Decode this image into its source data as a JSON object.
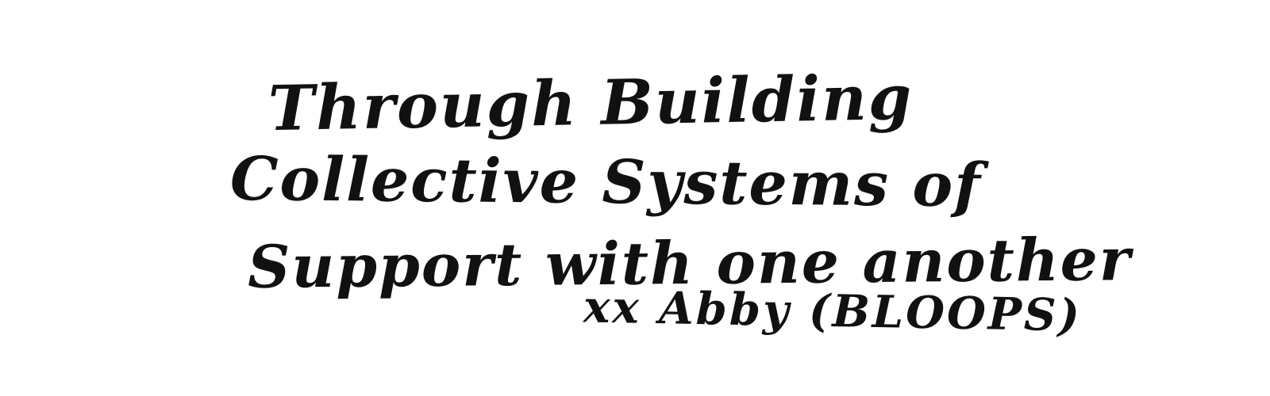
{
  "note": {
    "lines": [
      "Through Building",
      "Collective Systems of",
      "Support with one another"
    ],
    "signature": "xx Abby (BLOOPS)"
  },
  "colors": {
    "ink": "#111111",
    "paper": "#ffffff"
  }
}
